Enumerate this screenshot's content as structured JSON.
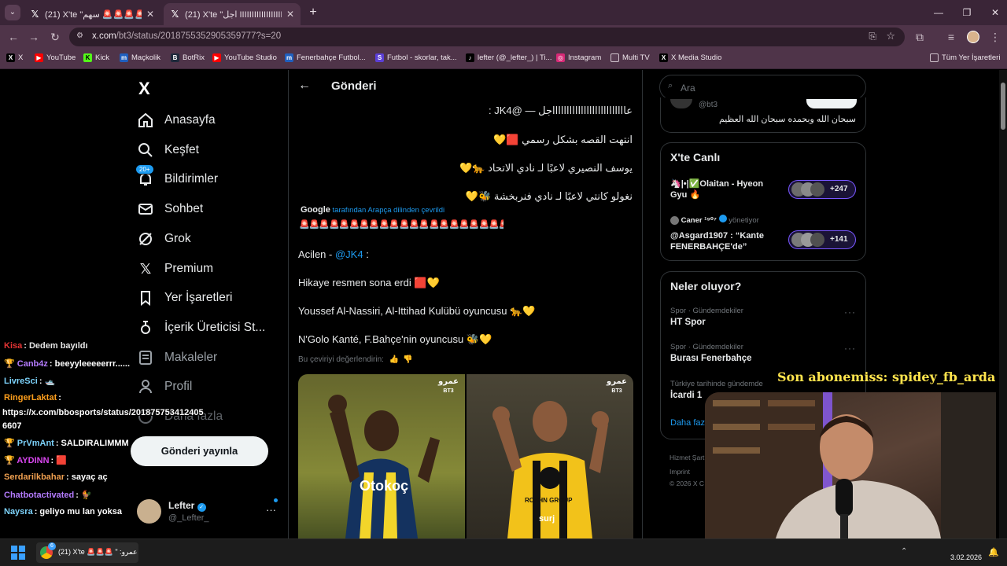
{
  "browser": {
    "tabs": [
      {
        "title": "(21) X'te \"سهم 🚨🚨🚨🚨🚨 | X",
        "active": false
      },
      {
        "title": "(21) X'te \"اجل IIIIIIIIIIIIIIIIIIIIIIII\"",
        "active": true
      }
    ],
    "new_tab": "+",
    "url_host": "x.com",
    "url_path": "/bt3/status/2018755352905359777?s=20",
    "bookmarks": [
      "X",
      "YouTube",
      "Kick",
      "Maçkolik",
      "BotRix",
      "YouTube Studio",
      "Fenerbahçe Futbol...",
      "Futbol - skorlar, tak...",
      "lefter (@_lefter_) | Ti...",
      "Instagram",
      "Multi TV",
      "X Media Studio"
    ],
    "all_bookmarks": "Tüm Yer İşaretleri"
  },
  "sidebar": {
    "logo": "X",
    "items": [
      {
        "label": "Anasayfa",
        "icon": "home-icon"
      },
      {
        "label": "Keşfet",
        "icon": "search-icon"
      },
      {
        "label": "Bildirimler",
        "icon": "bell-icon",
        "badge": "20+"
      },
      {
        "label": "Sohbet",
        "icon": "mail-icon"
      },
      {
        "label": "Grok",
        "icon": "grok-icon"
      },
      {
        "label": "Premium",
        "icon": "x-icon"
      },
      {
        "label": "Yer İşaretleri",
        "icon": "bookmark-icon"
      },
      {
        "label": "İçerik Üreticisi St...",
        "icon": "creator-icon"
      },
      {
        "label": "Makaleler",
        "icon": "article-icon"
      },
      {
        "label": "Profil",
        "icon": "person-icon"
      },
      {
        "label": "Daha fazla",
        "icon": "more-icon"
      }
    ],
    "post_button": "Gönderi yayınla",
    "account": {
      "name": "Lefter",
      "handle": "@_Lefter_"
    }
  },
  "main": {
    "header_title": "Gönderi",
    "arabic_lines": [
      "عااااااااااااااااااااااااااجل — @JK4 :",
      "انتهت القصه بشكل رسمي 🟥💛",
      "يوسف النصيري لاعبًا لـ نادي الاتحاد 🐆💛",
      "نغولو كانتي لاعبًا لـ نادي فنربخشة 🐝💛"
    ],
    "translated_by_brand": "Google",
    "translated_by": "tarafından Arapça dilinden çevrildi",
    "sirens": "🚨🚨🚨🚨🚨🚨🚨🚨🚨🚨🚨🚨🚨🚨🚨🚨🚨🚨🚨🚨🚨🚨🚨🚨🚨🚨🚨🚨🚨🚨",
    "translated_lines": [
      {
        "prefix": "Acilen - ",
        "mention": "@JK4",
        "suffix": " :"
      },
      {
        "prefix": "Hikaye resmen sona erdi 🟥💛",
        "mention": "",
        "suffix": ""
      },
      {
        "prefix": "Youssef Al-Nassiri, Al-Ittihad Kulübü oyuncusu 🐆💛",
        "mention": "",
        "suffix": ""
      },
      {
        "prefix": "N'Golo Kanté, F.Bahçe'nin oyuncusu 🐝💛",
        "mention": "",
        "suffix": ""
      }
    ],
    "rate_translation": "Bu çeviriyi değerlendirin:",
    "image_left": {
      "watermark_brand": "عمرو",
      "watermark_sub": "BT3",
      "jersey_text": "Otokoç"
    },
    "image_right": {
      "watermark_brand": "عمرو",
      "watermark_sub": "BT3",
      "jersey_text": "ROSHN GROUP",
      "sponsor": "surj"
    }
  },
  "right": {
    "search_placeholder": "Ara",
    "top_card": {
      "handle": "@bt3",
      "text": "سبحان الله وبحمده سبحان الله العظيم"
    },
    "live": {
      "title": "X'te Canlı",
      "items": [
        {
          "text": "🦄|•|✅Olaitan - Hyeon Gyu 🔥",
          "count": "+247"
        },
        {
          "host": "Caner ¹⁹⁰⁷",
          "role": "yönetiyor",
          "text": "@Asgard1907 : “Kante FENERBAHÇE'de”",
          "count": "+141"
        }
      ]
    },
    "trends": {
      "title": "Neler oluyor?",
      "items": [
        {
          "category": "Spor · Gündemdekiler",
          "name": "HT Spor"
        },
        {
          "category": "Spor · Gündemdekiler",
          "name": "Burası Fenerbahçe"
        },
        {
          "category": "Türkiye tarihinde gündemde",
          "name": "İcardi 1"
        }
      ],
      "show_more": "Daha fazl"
    },
    "footer": [
      "Hizmet Şart",
      "Imprint",
      "© 2026 X C"
    ]
  },
  "overlay": {
    "subscriber": "Son abonemiss: spidey_fb_arda",
    "chat": [
      {
        "user": "Kisa",
        "text": ": Dedem bayıldı",
        "color": "#ff3b3b"
      },
      {
        "user": "Canb4z",
        "text": ": beeyyleeeeerrr......",
        "color": "#b57cff"
      },
      {
        "user": "LivreSci",
        "text": ": 🛥️",
        "color": "#7dd3fc"
      },
      {
        "user": "RingerLaktat",
        "text": ":",
        "color": "#ff9f1c"
      },
      {
        "user": "https://x.com/bbosports/status/201875753412405",
        "text": "",
        "color": "#ffffff"
      },
      {
        "user": "6607",
        "text": "",
        "color": "#ffffff"
      },
      {
        "user": "PrVmAnt",
        "text": ": SALDIRALIMMM",
        "color": "#7dd3fc"
      },
      {
        "user": "AYDINN",
        "text": ": 🟥",
        "color": "#d946ef"
      },
      {
        "user": "Serdarilkbahar",
        "text": ": sayaç aç",
        "color": "#f0a050"
      },
      {
        "user": "Chatbotactivated",
        "text": ": 🐓",
        "color": "#b57cff"
      },
      {
        "user": "Naysra",
        "text": ": geliyo mu lan yoksa",
        "color": "#7dd3fc"
      }
    ]
  },
  "taskbar": {
    "chrome_badge": "6",
    "window_title": "(21) X'te 🚨🚨🚨 \" :عمرو",
    "date": "3.02.2026"
  }
}
